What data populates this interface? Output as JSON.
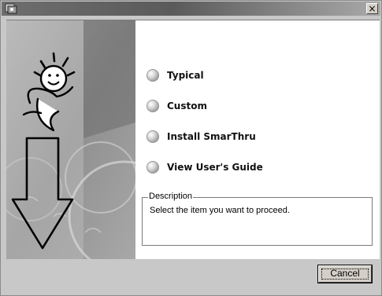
{
  "window": {
    "close_glyph": "×"
  },
  "options": [
    {
      "label": "Typical",
      "icon": "radio-bullet-icon"
    },
    {
      "label": "Custom",
      "icon": "radio-bullet-icon"
    },
    {
      "label": "Install SmarThru",
      "icon": "radio-bullet-icon"
    },
    {
      "label": "View User's Guide",
      "icon": "radio-bullet-icon"
    }
  ],
  "description": {
    "legend": "Description",
    "text": "Select the item you want to proceed."
  },
  "buttons": {
    "cancel_label": "Cancel"
  },
  "colors": {
    "titlebar_dark": "#5a5a5a",
    "frame_gray": "#c8c8c8",
    "content_bg": "#ffffff"
  }
}
